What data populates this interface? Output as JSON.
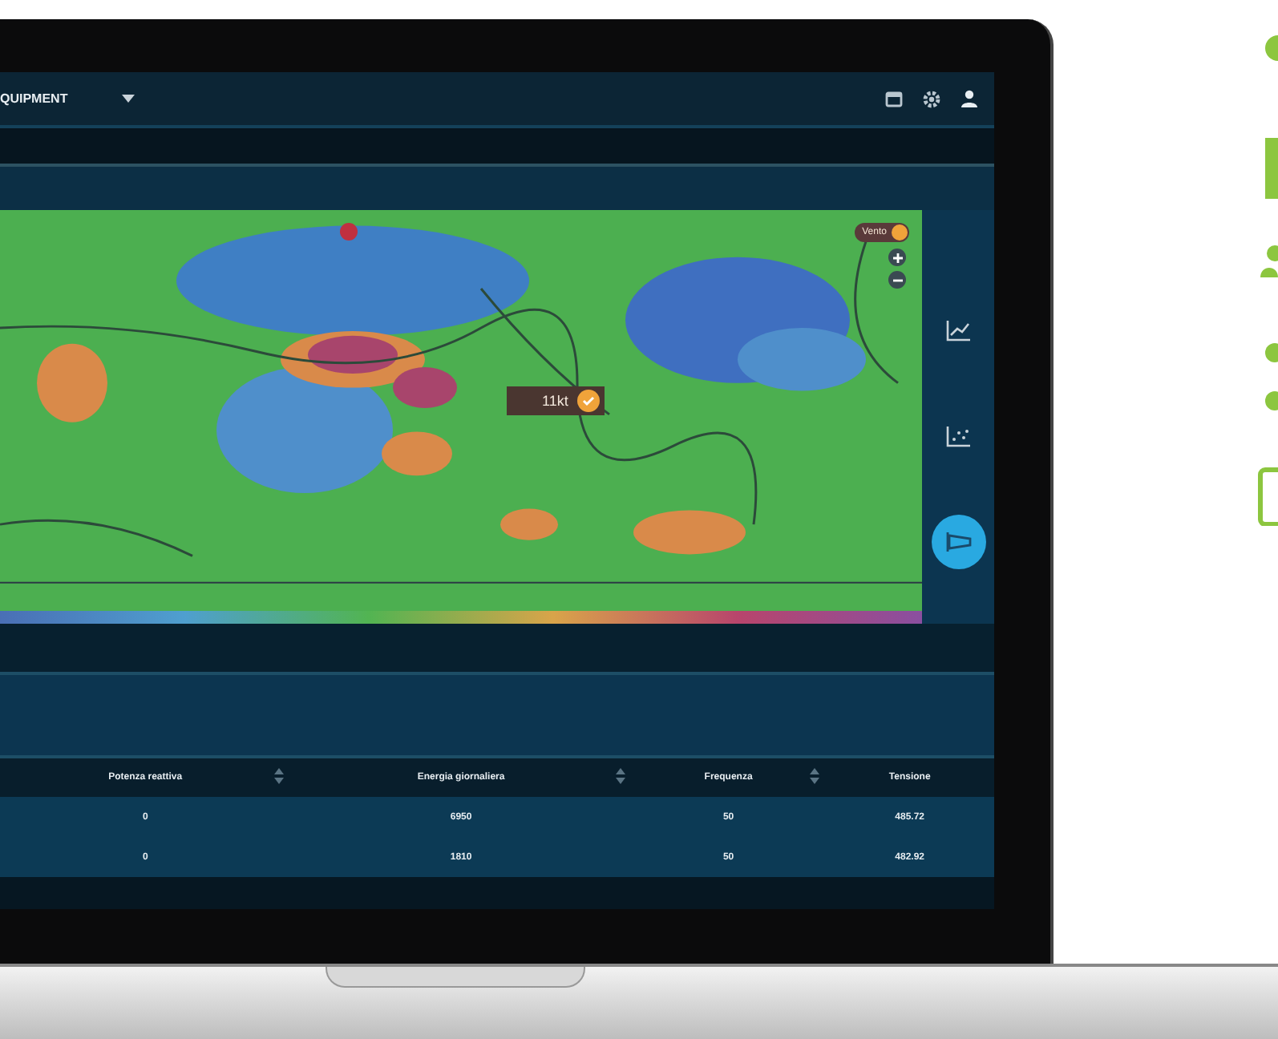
{
  "app_bar": {
    "title": "QUIPMENT"
  },
  "map": {
    "wind_label": "Vento",
    "marker_reading": "11kt"
  },
  "table": {
    "columns": [
      {
        "label": "Potenza reattiva",
        "sortable": true
      },
      {
        "label": "Energia giornaliera",
        "sortable": true
      },
      {
        "label": "Frequenza",
        "sortable": true
      },
      {
        "label": "Tensione",
        "sortable": false
      }
    ],
    "rows": [
      [
        "0",
        "6950",
        "50",
        "485.72"
      ],
      [
        "0",
        "1810",
        "50",
        "482.92"
      ]
    ]
  }
}
